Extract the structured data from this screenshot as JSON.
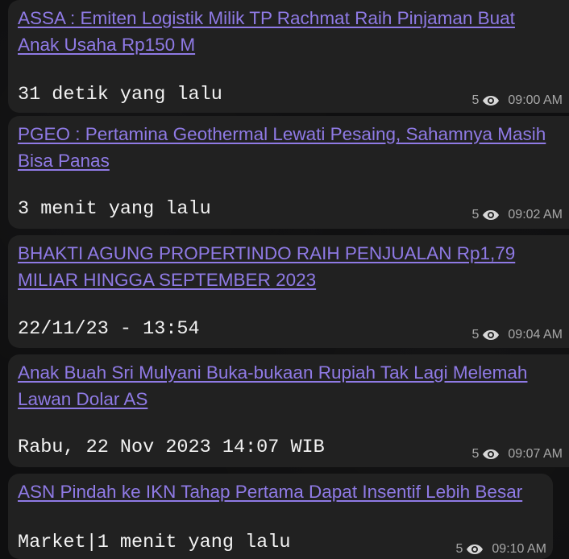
{
  "messages": [
    {
      "headline": "ASSA : Emiten Logistik Milik TP Rachmat  Raih Pinjaman Buat Anak Usaha Rp150 M",
      "subline": "31 detik yang lalu",
      "views": "5",
      "time": "09:00 AM"
    },
    {
      "headline": "PGEO : Pertamina Geothermal  Lewati Pesaing, Sahamnya Masih Bisa Panas",
      "subline": "3 menit yang lalu",
      "views": "5",
      "time": "09:02 AM"
    },
    {
      "headline": "BHAKTI AGUNG PROPERTINDO RAIH PENJUALAN Rp1,79 MILIAR HINGGA SEPTEMBER 2023",
      "subline": "22/11/23 - 13:54",
      "views": "5",
      "time": "09:04 AM"
    },
    {
      "headline": "Anak Buah Sri Mulyani Buka-bukaan Rupiah Tak Lagi Melemah Lawan Dolar AS",
      "subline": "Rabu, 22 Nov 2023 14:07 WIB",
      "views": "5",
      "time": "09:07 AM"
    },
    {
      "headline": "ASN Pindah ke IKN Tahap Pertama Dapat Insentif Lebih Besar",
      "subline": "Market|1 menit yang lalu",
      "views": "5",
      "time": "09:10 AM"
    }
  ],
  "icons": {
    "views": "eye-icon"
  },
  "colors": {
    "link": "#8f7ae5",
    "bubble": "#212121",
    "background": "#0f0f10",
    "meta": "#a7a7a7"
  }
}
